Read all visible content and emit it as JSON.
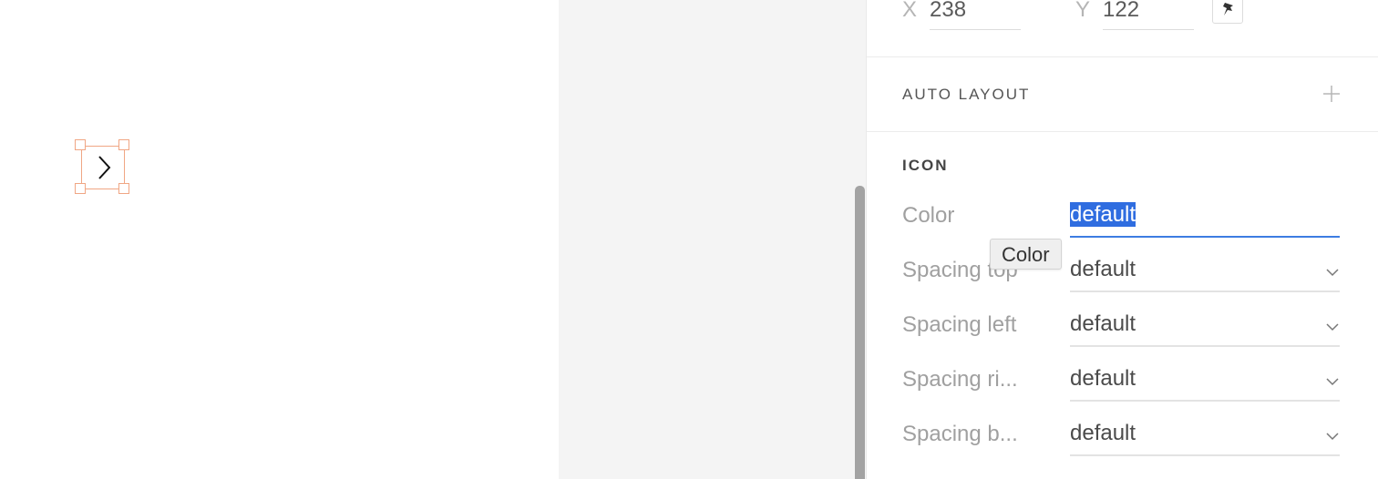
{
  "position": {
    "x_label": "X",
    "x_value": "238",
    "y_label": "Y",
    "y_value": "122",
    "pin_icon": "pin-icon"
  },
  "auto_layout": {
    "title": "AUTO LAYOUT",
    "add_icon": "plus-icon"
  },
  "icon_section": {
    "title": "ICON",
    "rows": [
      {
        "label": "Color",
        "value": "default",
        "kind": "text-input-selected"
      },
      {
        "label": "Spacing top",
        "value": "default",
        "kind": "dropdown"
      },
      {
        "label": "Spacing left",
        "value": "default",
        "kind": "dropdown"
      },
      {
        "label": "Spacing ri...",
        "value": "default",
        "kind": "dropdown"
      },
      {
        "label": "Spacing b...",
        "value": "default",
        "kind": "dropdown"
      }
    ]
  },
  "tooltip": {
    "text": "Color"
  },
  "canvas": {
    "selected_icon": "chevron-right-icon"
  },
  "colors": {
    "accent": "#2f6de0",
    "selection": "#f0a684"
  }
}
